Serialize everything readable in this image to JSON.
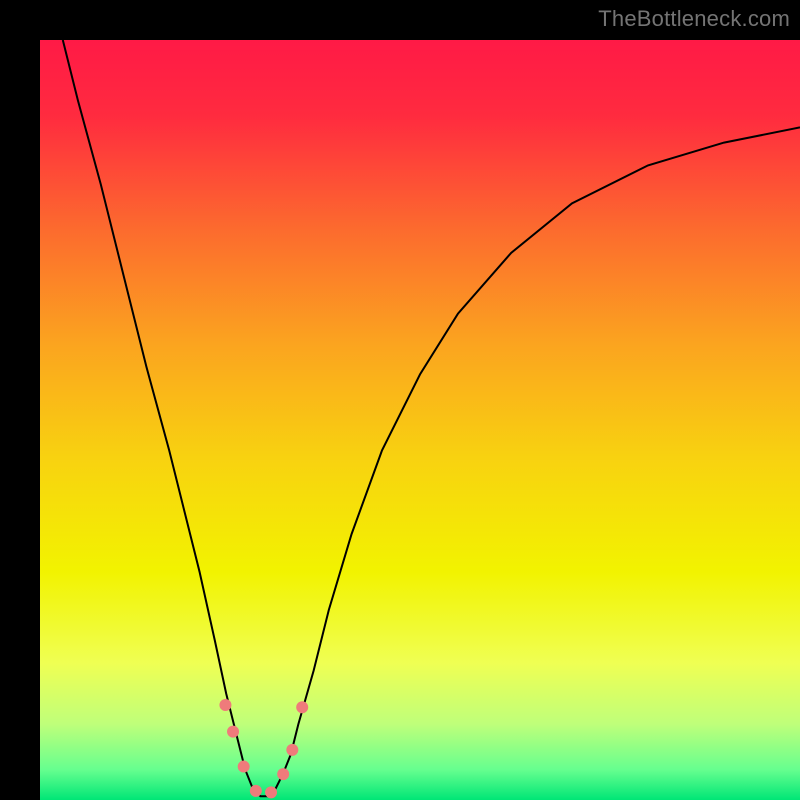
{
  "watermark": "TheBottleneck.com",
  "chart_data": {
    "type": "line",
    "title": "",
    "xlabel": "",
    "ylabel": "",
    "xlim": [
      0,
      100
    ],
    "ylim": [
      0,
      100
    ],
    "background_gradient": {
      "stops": [
        {
          "offset": 0.0,
          "color": "#ff1a46"
        },
        {
          "offset": 0.1,
          "color": "#ff2b3f"
        },
        {
          "offset": 0.25,
          "color": "#fc6b2e"
        },
        {
          "offset": 0.4,
          "color": "#fba41f"
        },
        {
          "offset": 0.55,
          "color": "#f8d210"
        },
        {
          "offset": 0.7,
          "color": "#f2f300"
        },
        {
          "offset": 0.82,
          "color": "#efff53"
        },
        {
          "offset": 0.9,
          "color": "#bfff7a"
        },
        {
          "offset": 0.96,
          "color": "#66ff8f"
        },
        {
          "offset": 1.0,
          "color": "#00e676"
        }
      ]
    },
    "series": [
      {
        "name": "bottleneck-curve",
        "stroke": "#000000",
        "x": [
          3,
          5,
          8,
          11,
          14,
          17,
          19,
          21,
          23,
          24.5,
          26,
          27,
          28,
          29,
          30,
          31,
          32,
          33,
          34,
          36,
          38,
          41,
          45,
          50,
          55,
          62,
          70,
          80,
          90,
          100
        ],
        "y": [
          100,
          92,
          81,
          69,
          57,
          46,
          38,
          30,
          21,
          14,
          8,
          4,
          1.5,
          0.5,
          0.5,
          1.5,
          3.5,
          6,
          10,
          17,
          25,
          35,
          46,
          56,
          64,
          72,
          78.5,
          83.5,
          86.5,
          88.5
        ]
      }
    ],
    "markers": {
      "name": "valley-dots",
      "color": "#ef7b7b",
      "radius": 6,
      "points": [
        {
          "x": 24.4,
          "y": 12.5
        },
        {
          "x": 25.4,
          "y": 9.0
        },
        {
          "x": 26.8,
          "y": 4.4
        },
        {
          "x": 28.4,
          "y": 1.2
        },
        {
          "x": 30.4,
          "y": 1.0
        },
        {
          "x": 32.0,
          "y": 3.4
        },
        {
          "x": 33.2,
          "y": 6.6
        },
        {
          "x": 34.5,
          "y": 12.2
        }
      ]
    }
  },
  "colors": {
    "frame": "#000000",
    "curve": "#000000",
    "marker": "#ef7b7b",
    "watermark": "#747474"
  }
}
